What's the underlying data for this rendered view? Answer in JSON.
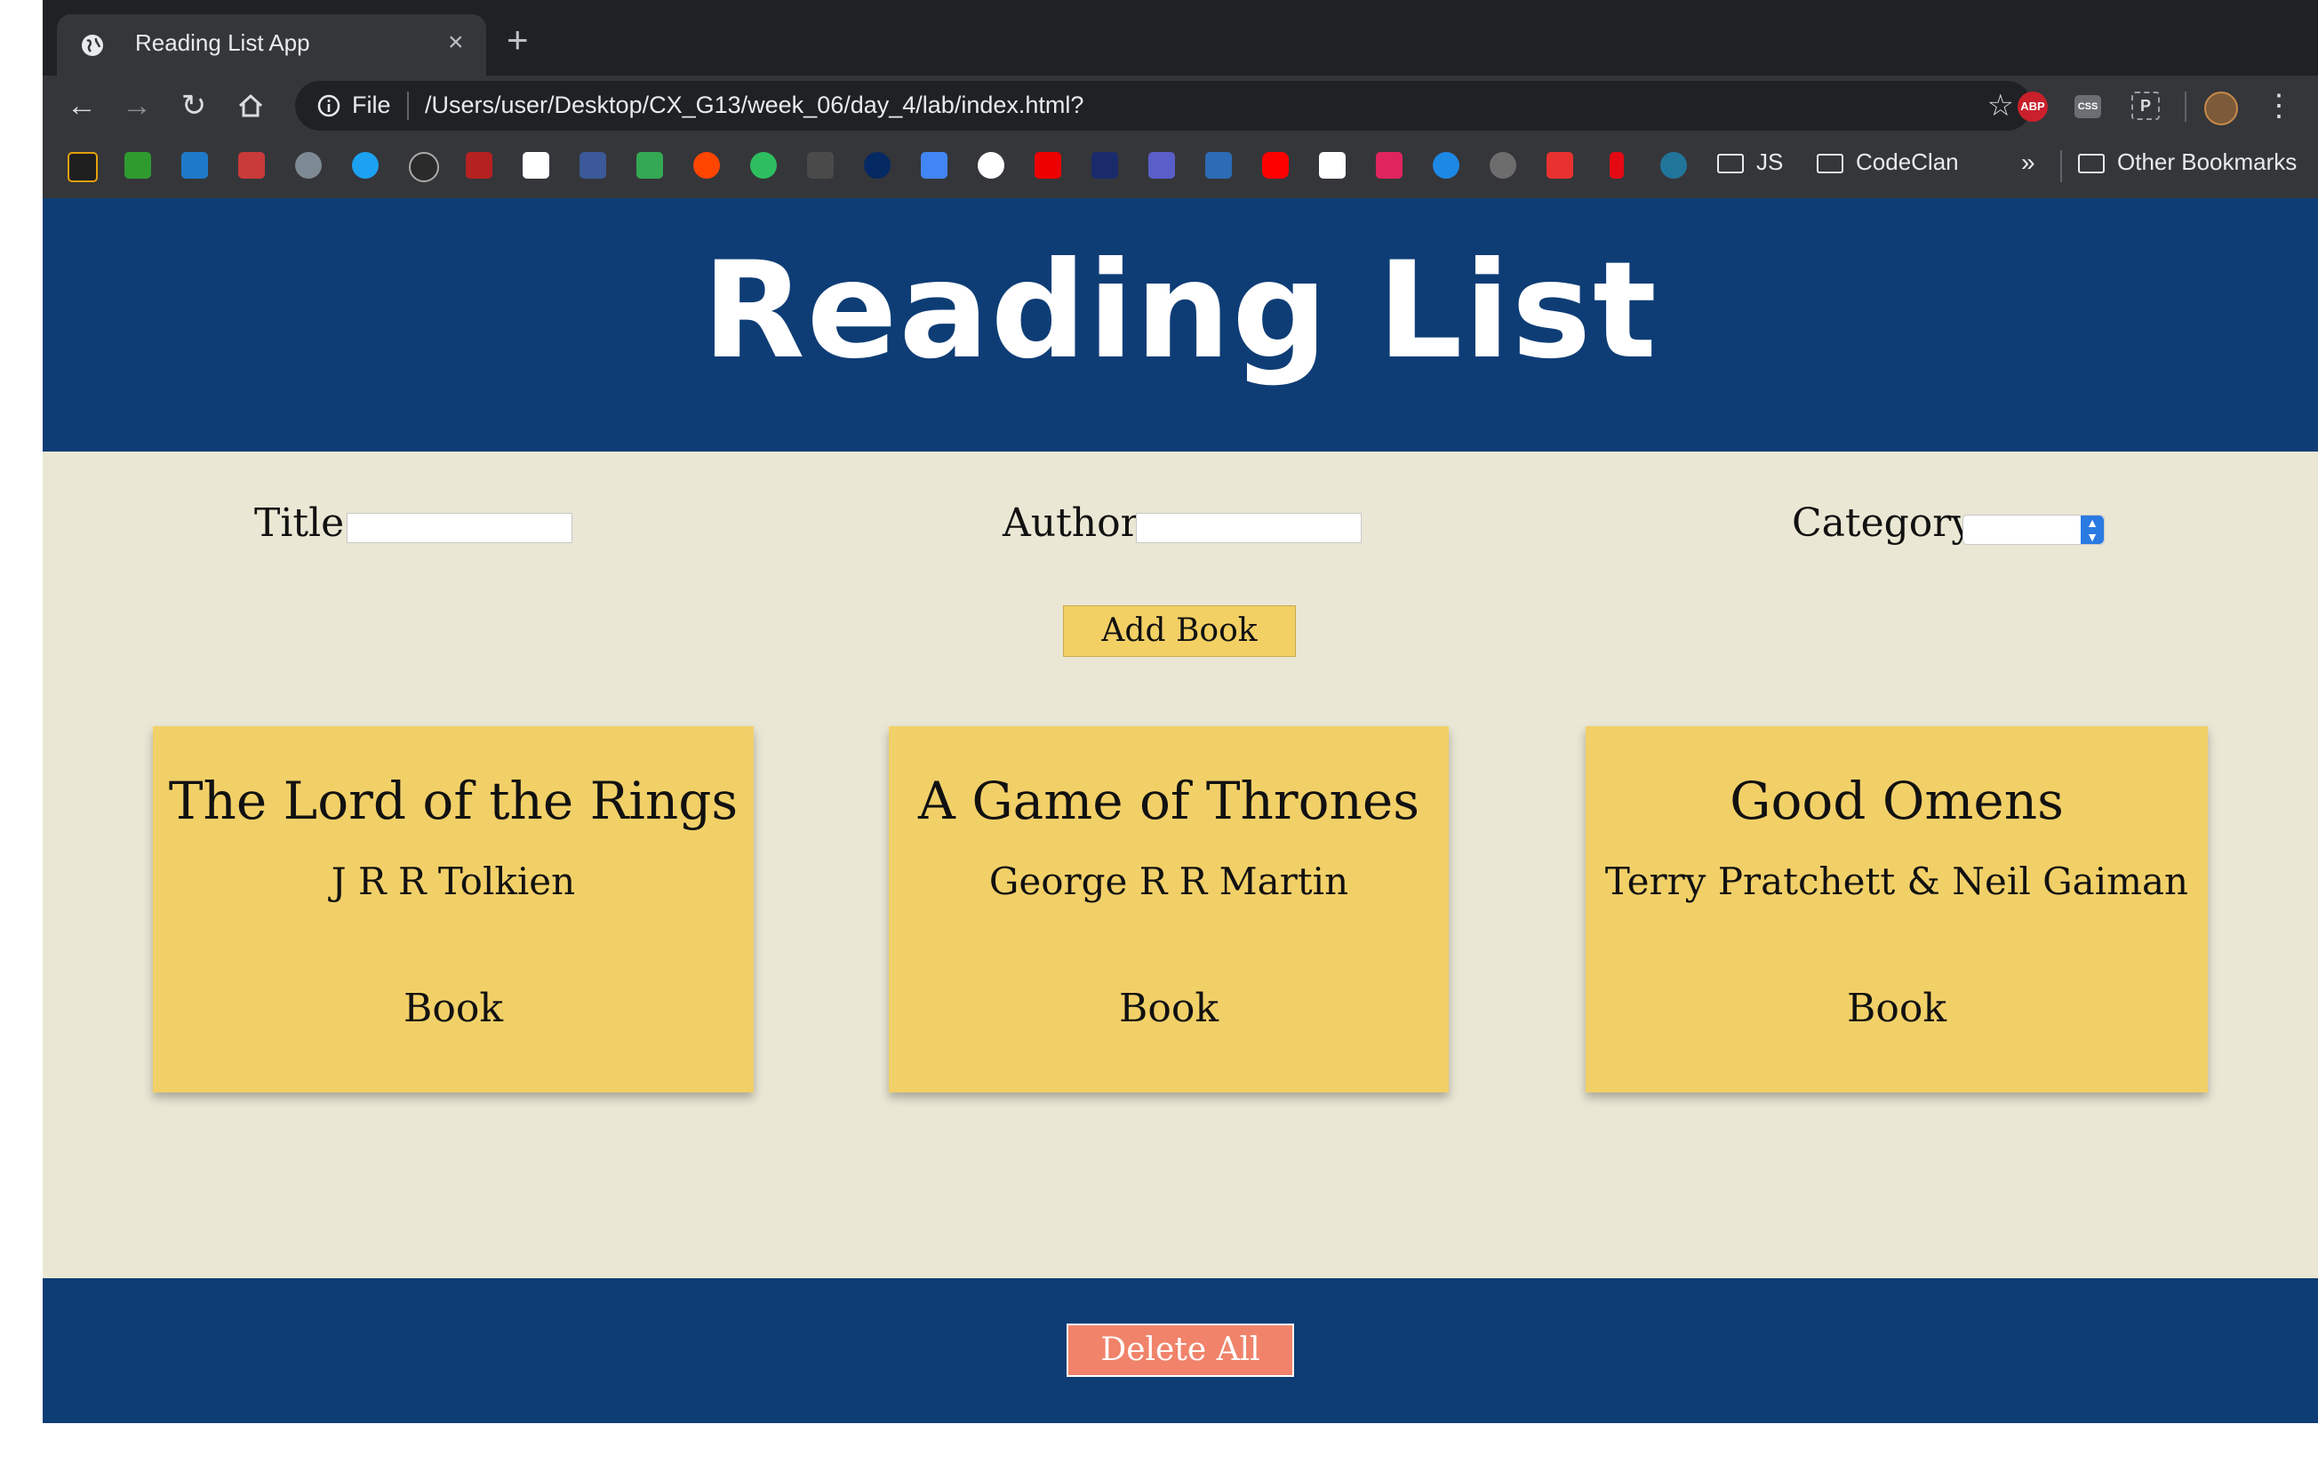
{
  "browser": {
    "tab_title": "Reading List App",
    "tab_close": "×",
    "new_tab": "+",
    "url_scheme": "File",
    "url": "/Users/user/Desktop/CX_G13/week_06/day_4/lab/index.html?",
    "extensions": [
      "ABP",
      "CSS",
      "P"
    ],
    "bookmark_folders": [
      "JS",
      "CodeClan"
    ],
    "bookmarks_overflow": "»",
    "other_bookmarks": "Other Bookmarks"
  },
  "page": {
    "title": "Reading List",
    "form": {
      "title_label": "Title",
      "author_label": "Author",
      "category_label": "Category",
      "title_value": "",
      "author_value": "",
      "category_value": "",
      "add_button": "Add Book"
    },
    "books": [
      {
        "title": "The Lord of the Rings",
        "author": "J R R Tolkien",
        "category": "Book"
      },
      {
        "title": "A Game of Thrones",
        "author": "George R R Martin",
        "category": "Book"
      },
      {
        "title": "Good Omens",
        "author": "Terry Pratchett & Neil Gaiman",
        "category": "Book"
      }
    ],
    "delete_button": "Delete All"
  },
  "colors": {
    "header_blue": "#0e3d76",
    "page_bg": "#eae7d4",
    "card_yellow": "#f2d068",
    "delete_red": "#f0836a"
  }
}
